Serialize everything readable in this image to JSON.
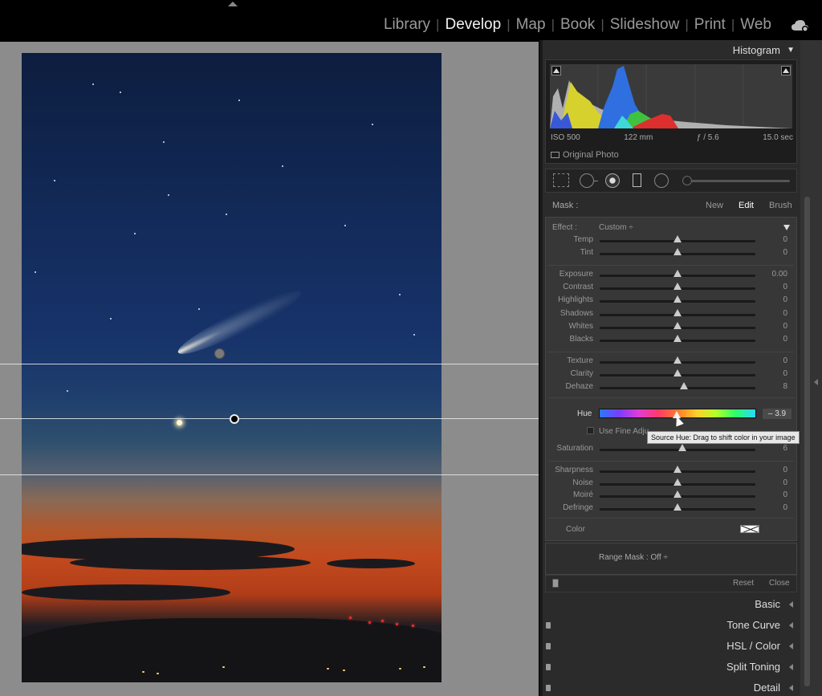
{
  "modules": [
    "Library",
    "Develop",
    "Map",
    "Book",
    "Slideshow",
    "Print",
    "Web"
  ],
  "active_module": "Develop",
  "histogram": {
    "title": "Histogram",
    "iso": "ISO 500",
    "focal": "122 mm",
    "aperture": "ƒ / 5.6",
    "shutter": "15.0 sec",
    "original_photo": "Original Photo"
  },
  "mask": {
    "label": "Mask :",
    "new": "New",
    "edit": "Edit",
    "brush": "Brush"
  },
  "effect": {
    "label": "Effect :",
    "value": "Custom ÷"
  },
  "sliders": [
    {
      "label": "Temp",
      "value": "0",
      "pos": 0.5
    },
    {
      "label": "Tint",
      "value": "0",
      "pos": 0.5
    },
    {
      "label": "Exposure",
      "value": "0.00",
      "pos": 0.5
    },
    {
      "label": "Contrast",
      "value": "0",
      "pos": 0.5
    },
    {
      "label": "Highlights",
      "value": "0",
      "pos": 0.5
    },
    {
      "label": "Shadows",
      "value": "0",
      "pos": 0.5
    },
    {
      "label": "Whites",
      "value": "0",
      "pos": 0.5
    },
    {
      "label": "Blacks",
      "value": "0",
      "pos": 0.5
    },
    {
      "label": "Texture",
      "value": "0",
      "pos": 0.5
    },
    {
      "label": "Clarity",
      "value": "0",
      "pos": 0.5
    },
    {
      "label": "Dehaze",
      "value": "8",
      "pos": 0.54
    },
    {
      "label": "Saturation",
      "value": "6",
      "pos": 0.53
    },
    {
      "label": "Sharpness",
      "value": "0",
      "pos": 0.5
    },
    {
      "label": "Noise",
      "value": "0",
      "pos": 0.5
    },
    {
      "label": "Moiré",
      "value": "0",
      "pos": 0.5
    },
    {
      "label": "Defringe",
      "value": "0",
      "pos": 0.5
    }
  ],
  "hue": {
    "label": "Hue",
    "value": "– 3.9",
    "fine_label": "Use Fine Adju",
    "tooltip": "Source Hue: Drag to shift color in your image"
  },
  "color_label": "Color",
  "range_mask": "Range Mask : Off ÷",
  "footer": {
    "reset": "Reset",
    "close": "Close"
  },
  "sections": [
    "Basic",
    "Tone Curve",
    "HSL / Color",
    "Split Toning",
    "Detail"
  ],
  "colors": {
    "accent": "#f2f2f2",
    "panel_bg": "#2b2b2b"
  }
}
